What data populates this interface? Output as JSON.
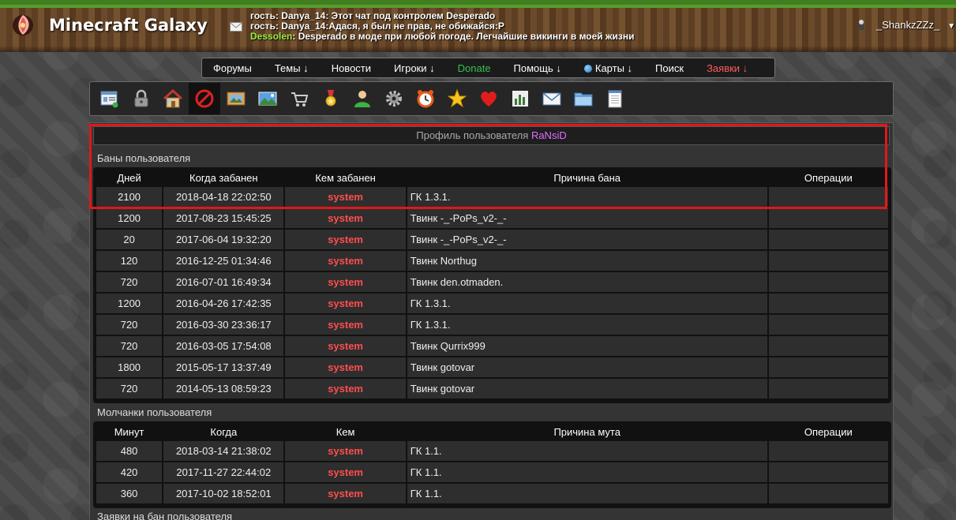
{
  "site": {
    "title": "Minecraft Galaxy"
  },
  "chat": [
    {
      "nick": "гость",
      "text": ": Danya_14: Этот чат под контролем Desperado",
      "nick_color": "white"
    },
    {
      "nick": "гость",
      "text": ": Danya_14:Адася, я был не прав, не обижайся:P",
      "nick_color": "white"
    },
    {
      "nick": "Dessolen",
      "text": ": Desperado в моде при любой погоде. Легчайшие викинги в моей жизни",
      "nick_color": "green"
    }
  ],
  "user": {
    "name": "_ShankzZZz_"
  },
  "nav": {
    "items": [
      {
        "label": "Форумы",
        "style": "normal"
      },
      {
        "label": "Темы ↓",
        "style": "normal"
      },
      {
        "label": "Новости",
        "style": "normal"
      },
      {
        "label": "Игроки ↓",
        "style": "normal"
      },
      {
        "label": "Donate",
        "style": "green"
      },
      {
        "label": "Помощь ↓",
        "style": "normal"
      },
      {
        "label": "Карты ↓",
        "style": "normal",
        "icon": "globe-icon"
      },
      {
        "label": "Поиск",
        "style": "normal"
      },
      {
        "label": "Заявки ↓",
        "style": "red"
      }
    ]
  },
  "toolbar": {
    "icons": [
      "id-card-icon",
      "lock-icon",
      "home-icon",
      "ban-icon",
      "picture-icon",
      "landscape-icon",
      "cart-icon",
      "medal-icon",
      "user-icon",
      "gear-icon",
      "clock-icon",
      "star-icon",
      "heart-icon",
      "chart-icon",
      "mail-icon",
      "folder-icon",
      "notepad-icon"
    ],
    "active_index": 3
  },
  "profile": {
    "prefix": "Профиль пользователя",
    "username": "RaNsiD"
  },
  "bans": {
    "title": "Баны пользователя",
    "headers": [
      "Дней",
      "Когда забанен",
      "Кем забанен",
      "Причина бана",
      "Операции"
    ],
    "rows": [
      {
        "days": "2100",
        "when": "2018-04-18 22:02:50",
        "by": "system",
        "reason": "ГК 1.3.1.",
        "reason_color": "green"
      },
      {
        "days": "1200",
        "when": "2017-08-23 15:45:25",
        "by": "system",
        "reason": "Твинк -_-PoPs_v2-_-",
        "reason_color": "red"
      },
      {
        "days": "20",
        "when": "2017-06-04 19:32:20",
        "by": "system",
        "reason": "Твинк -_-PoPs_v2-_-",
        "reason_color": "red"
      },
      {
        "days": "120",
        "when": "2016-12-25 01:34:46",
        "by": "system",
        "reason": "Твинк Northug",
        "reason_color": "red"
      },
      {
        "days": "720",
        "when": "2016-07-01 16:49:34",
        "by": "system",
        "reason": "Твинк den.otmaden.",
        "reason_color": "red"
      },
      {
        "days": "1200",
        "when": "2016-04-26 17:42:35",
        "by": "system",
        "reason": "ГК 1.3.1.",
        "reason_color": "red"
      },
      {
        "days": "720",
        "when": "2016-03-30 23:36:17",
        "by": "system",
        "reason": "ГК 1.3.1.",
        "reason_color": "red"
      },
      {
        "days": "720",
        "when": "2016-03-05 17:54:08",
        "by": "system",
        "reason": "Твинк Qurrix999",
        "reason_color": "red"
      },
      {
        "days": "1800",
        "when": "2015-05-17 13:37:49",
        "by": "system",
        "reason": "Твинк gotovar",
        "reason_color": "red"
      },
      {
        "days": "720",
        "when": "2014-05-13 08:59:23",
        "by": "system",
        "reason": "Твинк gotovar",
        "reason_color": "red"
      }
    ]
  },
  "mutes": {
    "title": "Молчанки пользователя",
    "headers": [
      "Минут",
      "Когда",
      "Кем",
      "Причина мута",
      "Операции"
    ],
    "rows": [
      {
        "mins": "480",
        "when": "2018-03-14 21:38:02",
        "by": "system",
        "reason": "ГК 1.1."
      },
      {
        "mins": "420",
        "when": "2017-11-27 22:44:02",
        "by": "system",
        "reason": "ГК 1.1."
      },
      {
        "mins": "360",
        "when": "2017-10-02 18:52:01",
        "by": "system",
        "reason": "ГК 1.1."
      }
    ]
  },
  "requests": {
    "title": "Заявки на бан пользователя"
  }
}
